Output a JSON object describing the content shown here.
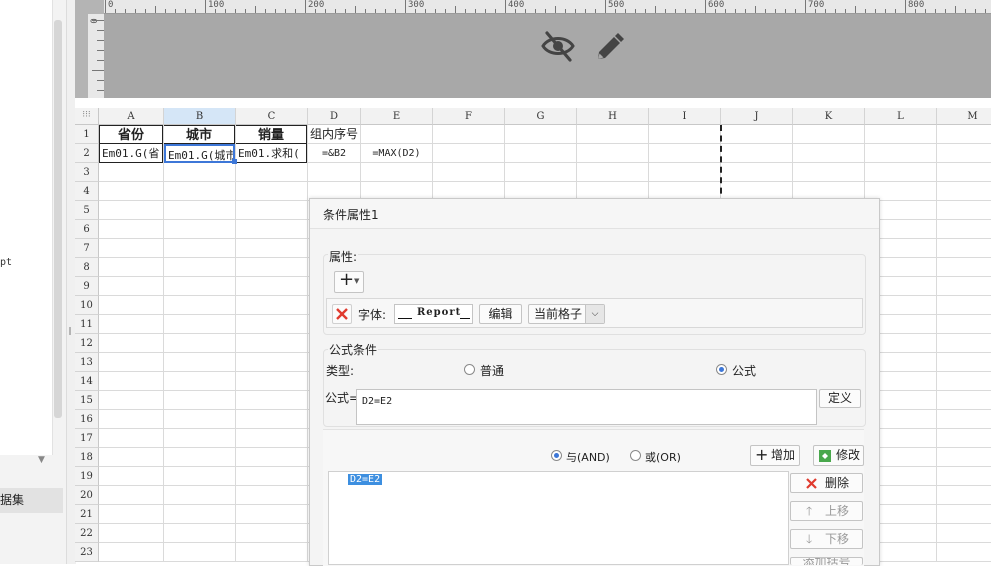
{
  "left_panel": {
    "label_pt": "pt",
    "dataset_tab": "据集"
  },
  "ruler": {
    "top_labels": [
      "0",
      "100",
      "200",
      "300",
      "400",
      "500",
      "600",
      "700",
      "800"
    ],
    "left_label": "0"
  },
  "header_icons": [
    "eye-slash-icon",
    "pencil-icon"
  ],
  "sheet": {
    "columns": [
      "A",
      "B",
      "C",
      "D",
      "E",
      "F",
      "G",
      "H",
      "I",
      "J",
      "K",
      "L",
      "M"
    ],
    "selected_column": "B",
    "rows": [
      "1",
      "2",
      "3",
      "4",
      "5",
      "6",
      "7",
      "8",
      "9",
      "10",
      "11",
      "12",
      "13",
      "14",
      "15",
      "16",
      "17",
      "18",
      "19",
      "20",
      "21",
      "22",
      "23"
    ],
    "cells": {
      "A1": "省份",
      "B1": "城市",
      "C1": "销量",
      "D1": "组内序号",
      "A2": "Em01.G(省",
      "B2": "Em01.G(城市",
      "C2": "Em01.求和(",
      "D2": "=&B2",
      "E2": "=MAX(D2)"
    }
  },
  "dialog": {
    "title": "条件属性1",
    "attributes_label": "属性:",
    "add_symbol": "+",
    "font_label": "字体:",
    "font_preview": "Report",
    "edit_button": "编辑",
    "scope_select": "当前格子",
    "formula_section": "公式条件",
    "type_label": "类型:",
    "radio_normal": "普通",
    "radio_formula": "公式",
    "formula_label": "公式=",
    "formula_value": "D2=E2",
    "define_button": "定义",
    "radio_and": "与(AND)",
    "radio_or": "或(OR)",
    "add_button": "增加",
    "modify_button": "修改",
    "condition_items": [
      "D2=E2"
    ],
    "delete_button": "删除",
    "move_up_button": "上移",
    "move_down_button": "下移",
    "add_bracket_button": "添加括号"
  }
}
